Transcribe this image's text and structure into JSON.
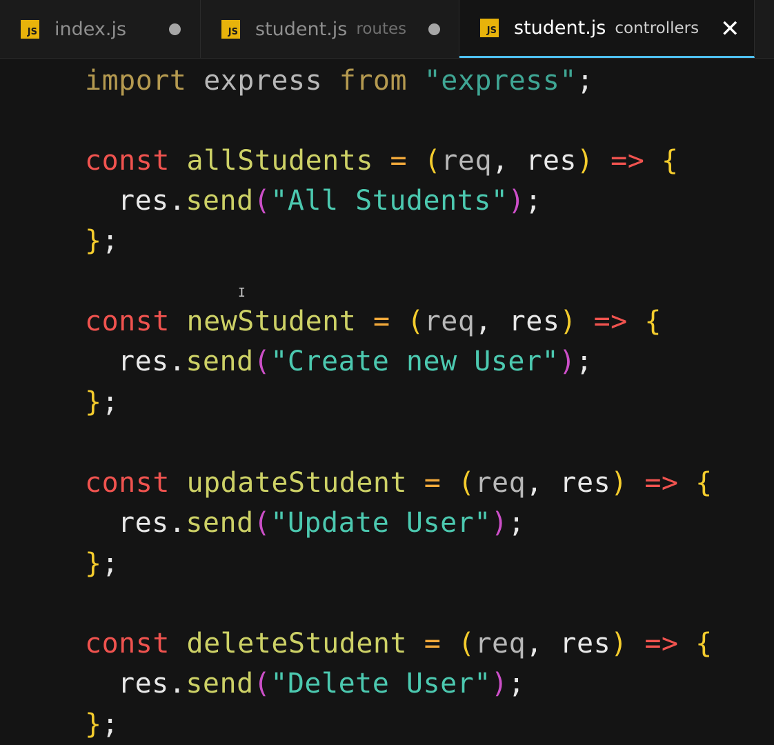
{
  "tabs": [
    {
      "icon": "JS",
      "name": "index.js",
      "desc": "",
      "modified": true,
      "active": false
    },
    {
      "icon": "JS",
      "name": "student.js",
      "desc": "routes",
      "modified": true,
      "active": false
    },
    {
      "icon": "JS",
      "name": "student.js",
      "desc": "controllers",
      "modified": false,
      "active": true
    }
  ],
  "close_glyph": "✕",
  "code": {
    "import_kw": "import",
    "import_name": "express",
    "from_kw": "from",
    "import_src": "\"express\"",
    "semicolon": ";",
    "const_kw": "const",
    "res": "res",
    "req": "req",
    "send": "send",
    "arrow": "=>",
    "open_brace": "{",
    "close_brace": "}",
    "functions": [
      {
        "name": "allStudents",
        "message": "\"All Students\""
      },
      {
        "name": "newStudent",
        "message": "\"Create new User\""
      },
      {
        "name": "updateStudent",
        "message": "\"Update User\""
      },
      {
        "name": "deleteStudent",
        "message": "\"Delete User\""
      }
    ]
  },
  "colors": {
    "background": "#141414",
    "tab_active_border": "#4fc1ff",
    "js_icon": "#e8b30b",
    "keyword_const": "#f0534f",
    "function_name": "#cdd166",
    "string": "#4cc9b0"
  }
}
